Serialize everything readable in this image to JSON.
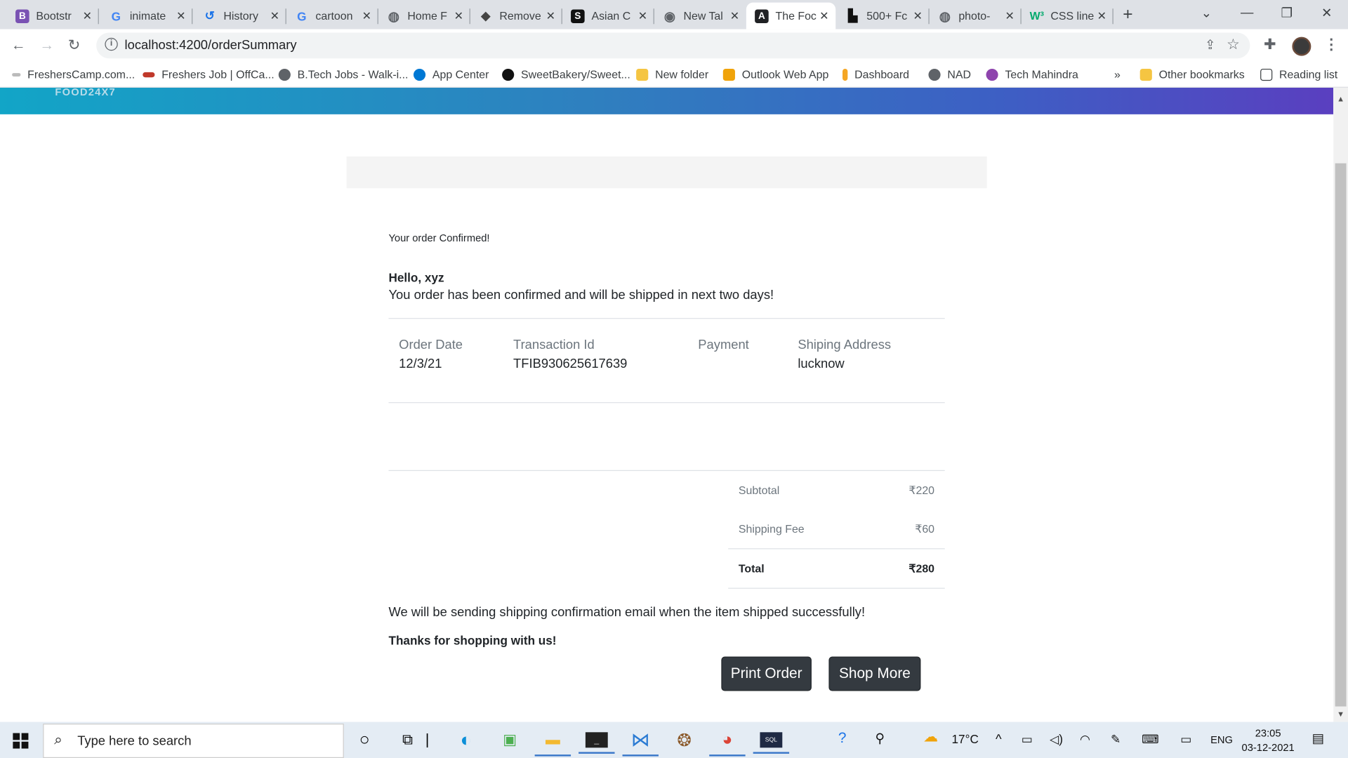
{
  "browser": {
    "tabs": [
      {
        "title": "Bootstr",
        "icon": "bootstrap-icon",
        "color": "#7952b3"
      },
      {
        "title": "inimate",
        "icon": "google-icon",
        "color": "#4285f4"
      },
      {
        "title": "History",
        "icon": "history-icon",
        "color": "#1a73e8"
      },
      {
        "title": "cartoon",
        "icon": "google-icon",
        "color": "#4285f4"
      },
      {
        "title": "Home F",
        "icon": "globe-icon",
        "color": "#5f6368"
      },
      {
        "title": "Remove",
        "icon": "layers-icon",
        "color": "#444"
      },
      {
        "title": "Asian C",
        "icon": "s-logo-icon",
        "color": "#111"
      },
      {
        "title": "New Tal",
        "icon": "chrome-icon",
        "color": "#5f6368"
      },
      {
        "title": "The Foc",
        "icon": "angular-icon",
        "color": "#202124"
      },
      {
        "title": "500+ Fc",
        "icon": "unsplash-icon",
        "color": "#111"
      },
      {
        "title": "photo-",
        "icon": "globe-icon",
        "color": "#5f6368"
      },
      {
        "title": "CSS line",
        "icon": "w3-icon",
        "color": "#04aa6d"
      }
    ],
    "address": "localhost:4200/orderSummary",
    "bookmarks": [
      {
        "label": "FreshersCamp.com...",
        "color": "#8a8a8a"
      },
      {
        "label": "Freshers Job | OffCa...",
        "color": "#c0392b"
      },
      {
        "label": "B.Tech Jobs - Walk-i...",
        "color": "#5f6368"
      },
      {
        "label": "App Center",
        "color": "#0078d4"
      },
      {
        "label": "SweetBakery/Sweet...",
        "color": "#111"
      },
      {
        "label": "New folder",
        "color": "#f5c542"
      },
      {
        "label": "Outlook Web App",
        "color": "#f0a30a"
      },
      {
        "label": "Dashboard",
        "color": "#f5a623"
      },
      {
        "label": "NAD",
        "color": "#5f6368"
      },
      {
        "label": "Tech Mahindra",
        "color": "#8e44ad"
      }
    ],
    "overflow": "»",
    "other_bookmarks": "Other bookmarks",
    "reading_list": "Reading list"
  },
  "page": {
    "brand": "FOOD24X7",
    "order_confirmed": "Your order Confirmed!",
    "greeting": "Hello, xyz",
    "message": "You order has been confirmed and will be shipped in next two days!",
    "details": {
      "order_date_label": "Order Date",
      "order_date": "12/3/21",
      "transaction_label": "Transaction Id",
      "transaction_id": "TFIB930625617639",
      "payment_label": "Payment",
      "payment": "",
      "address_label": "Shiping Address",
      "address": "lucknow"
    },
    "summary": {
      "subtotal_label": "Subtotal",
      "subtotal": "₹220",
      "shipping_label": "Shipping Fee",
      "shipping": "₹60",
      "total_label": "Total",
      "total": "₹280"
    },
    "footnote": "We will be sending shipping confirmation email when the item shipped successfully!",
    "thanks": "Thanks for shopping with us!",
    "print_button": "Print Order",
    "shop_button": "Shop More"
  },
  "taskbar": {
    "search_placeholder": "Type here to search",
    "temperature": "17°C",
    "language": "ENG",
    "time": "23:05",
    "date": "03-12-2021"
  },
  "colors": {
    "button_bg": "#343a40",
    "hero_start": "#12a5c7",
    "hero_end": "#5a3fc0"
  }
}
